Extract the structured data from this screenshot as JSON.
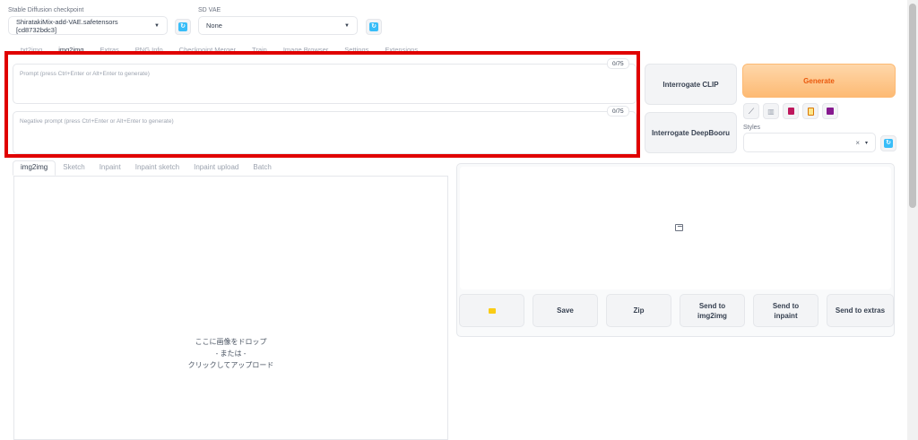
{
  "checkpoint": {
    "label": "Stable Diffusion checkpoint",
    "value": "ShiratakiMix-add-VAE.safetensors [cd8732bdc3]"
  },
  "vae": {
    "label": "SD VAE",
    "value": "None"
  },
  "main_tabs": [
    "txt2img",
    "img2img",
    "Extras",
    "PNG Info",
    "Checkpoint Merger",
    "Train",
    "Image Browser",
    "Settings",
    "Extensions"
  ],
  "prompt": {
    "placeholder": "Prompt (press Ctrl+Enter or Alt+Enter to generate)",
    "counter": "0/75"
  },
  "negative_prompt": {
    "placeholder": "Negative prompt (press Ctrl+Enter or Alt+Enter to generate)",
    "counter": "0/75"
  },
  "buttons": {
    "interrogate_clip": "Interrogate CLIP",
    "interrogate_deepbooru": "Interrogate DeepBooru",
    "generate": "Generate"
  },
  "styles": {
    "label": "Styles",
    "clear": "×",
    "caret": "▾"
  },
  "sub_tabs": [
    "img2img",
    "Sketch",
    "Inpaint",
    "Inpaint sketch",
    "Inpaint upload",
    "Batch"
  ],
  "drop_area": {
    "line1": "ここに画像をドロップ",
    "line2": "- または -",
    "line3": "クリックしてアップロード"
  },
  "actions": {
    "folder": "📁",
    "save": "Save",
    "zip": "Zip",
    "send_img2img_1": "Send to",
    "send_img2img_2": "img2img",
    "send_inpaint_1": "Send to",
    "send_inpaint_2": "inpaint",
    "send_extras": "Send to extras"
  },
  "colors": {
    "accent": "#ea580c",
    "highlight": "#e00000",
    "refresh": "#38bdf8"
  }
}
